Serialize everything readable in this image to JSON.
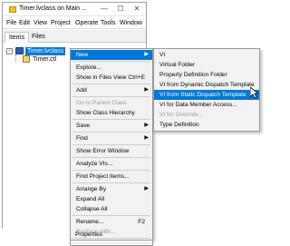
{
  "window": {
    "title": "Timer.lvclass on Main ...",
    "min": "—",
    "max": "☐",
    "close": "✕"
  },
  "menubar": [
    "File",
    "Edit",
    "View",
    "Project",
    "Operate",
    "Tools",
    "Window"
  ],
  "tabs": [
    "Items",
    "Files"
  ],
  "tree": {
    "root": "Timer.lvclass",
    "child": "Timer.ctl"
  },
  "context_menu": {
    "items": [
      {
        "label": "New",
        "arrow": "▶"
      },
      {
        "label": "Explore..."
      },
      {
        "label": "Show in Files View",
        "shortcut": "Ctrl+E"
      },
      {
        "label": "Add",
        "arrow": "▶"
      },
      {
        "label": "Go to Parent Class"
      },
      {
        "label": "Show Class Hierarchy"
      },
      {
        "label": "Save",
        "arrow": "▶"
      },
      {
        "label": "Find",
        "arrow": "▶"
      },
      {
        "label": "Show Error Window"
      },
      {
        "label": "Analyze VIs..."
      },
      {
        "label": "Find Project Items..."
      },
      {
        "label": "Arrange By",
        "arrow": "▶"
      },
      {
        "label": "Expand All"
      },
      {
        "label": "Collapse All"
      },
      {
        "label": "Rename...",
        "shortcut": "F2"
      },
      {
        "label": "Replace with..."
      },
      {
        "label": "Properties"
      }
    ]
  },
  "submenu": {
    "items": [
      "VI",
      "Virtual Folder",
      "Property Definition Folder",
      "VI from Dynamic Dispatch Template",
      "VI from Static Dispatch Template",
      "VI for Data Member Access...",
      "VI for Override...",
      "Type Definition"
    ]
  },
  "colors": {
    "highlight": "#0078d7",
    "menu_bg": "#f2f2f2",
    "disabled_text": "#9a9a9a"
  }
}
